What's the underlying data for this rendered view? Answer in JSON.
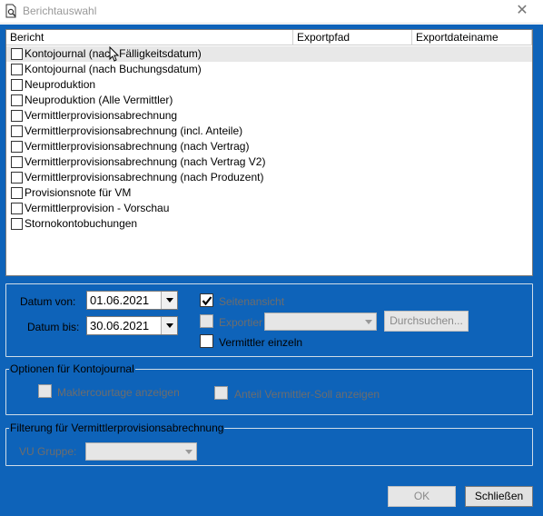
{
  "window": {
    "title": "Berichtauswahl",
    "close_glyph": "✕"
  },
  "list": {
    "columns": [
      "Bericht",
      "Exportpfad",
      "Exportdateiname"
    ],
    "items": [
      "Kontojournal (nach Fälligkeitsdatum)",
      "Kontojournal (nach Buchungsdatum)",
      "Neuproduktion",
      "Neuproduktion (Alle Vermittler)",
      "Vermittlerprovisionsabrechnung",
      "Vermittlerprovisionsabrechnung (incl. Anteile)",
      "Vermittlerprovisionsabrechnung (nach Vertrag)",
      "Vermittlerprovisionsabrechnung (nach Vertrag V2)",
      "Vermittlerprovisionsabrechnung (nach Produzent)",
      "Provisionsnote für VM",
      "Vermittlerprovision - Vorschau",
      "Stornokontobuchungen"
    ]
  },
  "dates": {
    "from_label": "Datum von:",
    "from_value": "01.06.2021",
    "to_label": "Datum bis:",
    "to_value": "30.06.2021"
  },
  "options": {
    "seitenansicht": "Seitenansicht",
    "exportieren": "Exportier",
    "durchsuchen": "Durchsuchen...",
    "vermittler_einzeln": "Vermittler einzeln"
  },
  "kontojournal": {
    "title": "Optionen für Kontojournal",
    "maklercourtage": "Maklercourtage anzeigen",
    "anteil": "Anteil Vermittler-Soll anzeigen"
  },
  "filter": {
    "title": "Filterung für Vermittlerprovisionsabrechnung",
    "vu_gruppe": "VU Gruppe:"
  },
  "buttons": {
    "ok": "OK",
    "close": "Schließen"
  },
  "colors": {
    "client_bg": "#0e63b9"
  }
}
